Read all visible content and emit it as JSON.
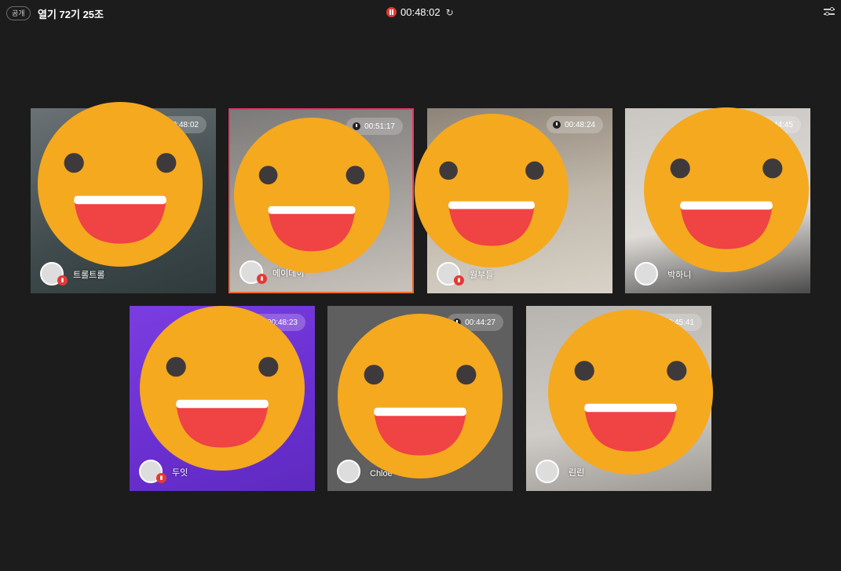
{
  "header": {
    "badge": "공개",
    "title": "열기 72기 25조",
    "elapsed": "00:48:02",
    "recording_color": "#e53935",
    "settings_icon": "sliders-icon"
  },
  "participants": [
    {
      "name": "트롤트롤",
      "time": "00:48:02",
      "active": false,
      "bg": "linear-gradient(160deg,#6b7275,#3f4a4c 60%,#2e3a3c)"
    },
    {
      "name": "메이데이",
      "time": "00:51:17",
      "active": true,
      "bg": "linear-gradient(170deg,#7c7a78,#a5a19d 55%,#c8c2bb)"
    },
    {
      "name": "월부들",
      "time": "00:48:24",
      "active": false,
      "bg": "linear-gradient(170deg,#8d8376,#bfb7aa 50%,#d8d2c8)"
    },
    {
      "name": "박하니",
      "time": "00:44:45",
      "active": false,
      "bg": "linear-gradient(170deg,#c9c6c2,#dedbd7 60%,#4a4a4a)"
    },
    {
      "name": "두잇",
      "time": "00:48:23",
      "active": false,
      "bg": "linear-gradient(160deg,#7b3de0,#6a2fd0 60%,#5e2ac0)"
    },
    {
      "name": "Chloe",
      "time": "00:44:27",
      "active": false,
      "bg": "#5f5f5f"
    },
    {
      "name": "린린",
      "time": "00:45:41",
      "active": false,
      "bg": "linear-gradient(170deg,#b7b4b0,#cfcbc7 60%,#9c9894)"
    }
  ]
}
